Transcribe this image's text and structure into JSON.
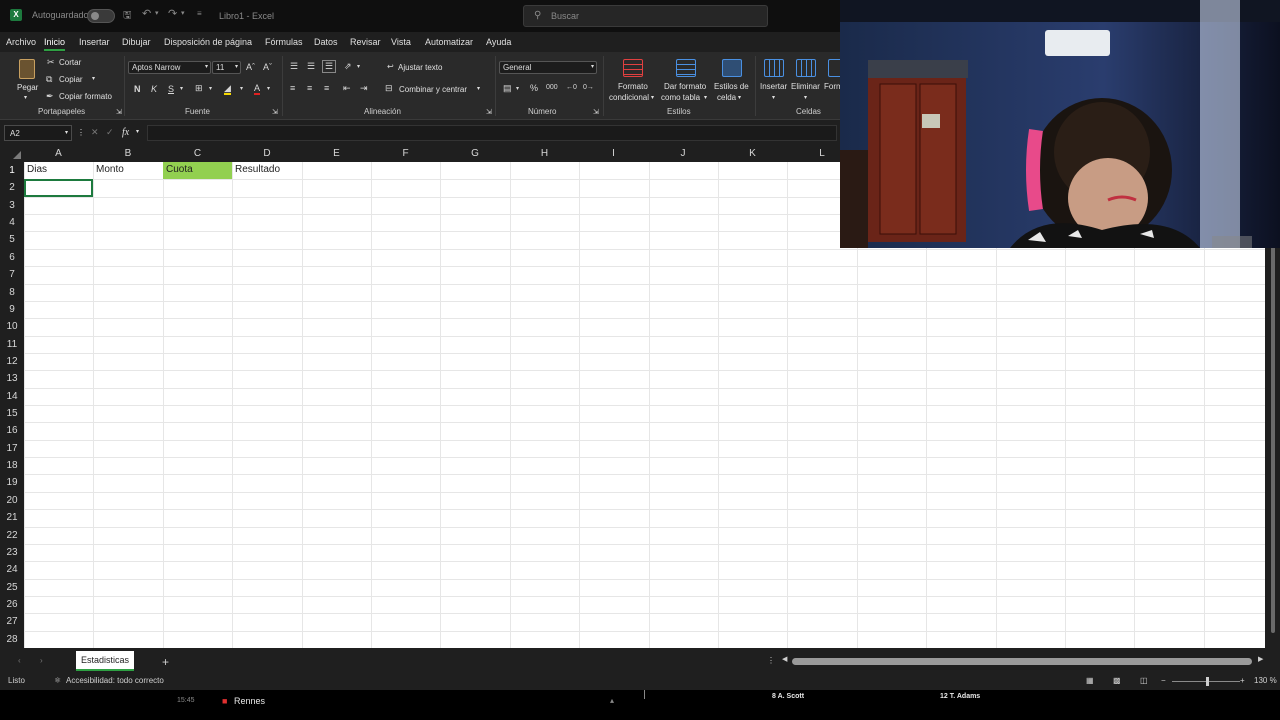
{
  "titlebar": {
    "autosave_label": "Autoguardado",
    "doc_title": "Libro1 - Excel",
    "search_placeholder": "Buscar"
  },
  "menu": [
    "Archivo",
    "Inicio",
    "Insertar",
    "Dibujar",
    "Disposición de página",
    "Fórmulas",
    "Datos",
    "Revisar",
    "Vista",
    "Automatizar",
    "Ayuda"
  ],
  "ribbon": {
    "clipboard": {
      "paste": "Pegar",
      "cut": "Cortar",
      "copy": "Copiar",
      "format_painter": "Copiar formato",
      "group": "Portapapeles"
    },
    "font": {
      "name": "Aptos Narrow",
      "size": "11",
      "bold": "N",
      "italic": "K",
      "underline": "S",
      "group": "Fuente"
    },
    "alignment": {
      "wrap": "Ajustar texto",
      "merge": "Combinar y centrar",
      "group": "Alineación"
    },
    "number": {
      "format": "General",
      "group": "Número"
    },
    "styles": {
      "conditional_1": "Formato",
      "conditional_2": "condicional",
      "table_1": "Dar formato",
      "table_2": "como tabla",
      "cell_1": "Estilos de",
      "cell_2": "celda",
      "group": "Estilos"
    },
    "cells": {
      "insert": "Insertar",
      "delete": "Eliminar",
      "format": "Form",
      "group": "Celdas"
    }
  },
  "formula_bar": {
    "name_box": "A2",
    "fx": "fx",
    "content": ""
  },
  "columns": [
    "A",
    "B",
    "C",
    "D",
    "E",
    "F",
    "G",
    "H",
    "I",
    "J",
    "K",
    "L"
  ],
  "rows": [
    "1",
    "2",
    "3",
    "4",
    "5",
    "6",
    "7",
    "8",
    "9",
    "10",
    "11",
    "12",
    "13",
    "14",
    "15",
    "16",
    "17",
    "18",
    "19",
    "20",
    "21",
    "22",
    "23",
    "24",
    "25",
    "26",
    "27",
    "28"
  ],
  "cells": {
    "A1": "Dias",
    "B1": "Monto",
    "C1": "Cuota",
    "D1": "Resultado"
  },
  "colors": {
    "highlight_fill": "#92d050",
    "accent": "#2ea043"
  },
  "sheet_tabs": {
    "active": "Estadisticas"
  },
  "statusbar": {
    "ready": "Listo",
    "accessibility": "Accesibilidad: todo correcto",
    "zoom": "130 %"
  },
  "overlay_bar": {
    "time": "15:45",
    "team": "Rennes",
    "player1": "8 A. Scott",
    "player2": "12 T. Adams"
  }
}
